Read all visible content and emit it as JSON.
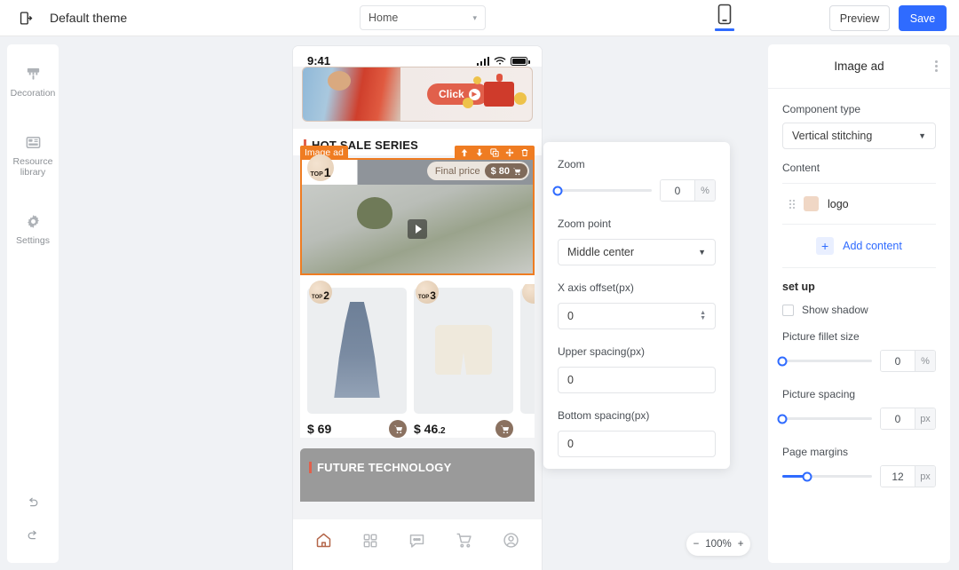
{
  "header": {
    "exit_icon": "exit-icon",
    "theme_title": "Default theme",
    "page_select": {
      "value": "Home",
      "caret": "▾"
    },
    "device_icon": "mobile-device-icon",
    "preview_label": "Preview",
    "save_label": "Save",
    "accent_color": "#2f6bff"
  },
  "sidebar": {
    "items": [
      {
        "icon": "brush-icon",
        "label": "Decoration"
      },
      {
        "icon": "layout-icon",
        "label": "Resource\nlibrary"
      },
      {
        "icon": "gear-icon",
        "label": "Settings"
      }
    ],
    "labels": [
      "Decoration",
      "Resource library",
      "Settings"
    ],
    "resource_line1": "Resource",
    "resource_line2": "library",
    "undo_icon": "undo-icon",
    "redo_icon": "redo-icon"
  },
  "phone": {
    "status": {
      "time": "9:41",
      "signal_icon": "signal-icon",
      "wifi_icon": "wifi-icon",
      "battery_icon": "battery-icon"
    },
    "banner": {
      "click_label": "Click",
      "play_glyph": "▶"
    },
    "section_title": "HOT SALE SERIES",
    "selection": {
      "tag": "Image ad",
      "tools": [
        "move-up-icon",
        "move-down-icon",
        "duplicate-icon",
        "drag-move-icon",
        "delete-icon"
      ]
    },
    "hero": {
      "badge_prefix": "TOP",
      "badge_rank": "1",
      "final_price_label": "Final price",
      "price": "$ 80",
      "cart_icon": "cart-icon",
      "play_icon": "play-icon"
    },
    "products": [
      {
        "badge_prefix": "TOP",
        "rank": "2",
        "price": "$ 69",
        "price_decimal": "",
        "cart_icon": "cart-icon"
      },
      {
        "badge_prefix": "TOP",
        "rank": "3",
        "price": "$ 46",
        "price_decimal": ".2",
        "cart_icon": "cart-icon"
      }
    ],
    "next_section_title": "FUTURE TECHNOLOGY",
    "tabbar": [
      {
        "icon": "home-icon",
        "active": true
      },
      {
        "icon": "category-grid-icon",
        "active": false
      },
      {
        "icon": "chat-icon",
        "active": false
      },
      {
        "icon": "cart-icon",
        "active": false
      },
      {
        "icon": "profile-icon",
        "active": false
      }
    ]
  },
  "mid_panel": {
    "zoom_label": "Zoom",
    "zoom_value": "0",
    "zoom_unit": "%",
    "zoom_point_label": "Zoom point",
    "zoom_point_value": "Middle center",
    "x_offset_label": "X axis offset(px)",
    "x_offset_value": "0",
    "upper_spacing_label": "Upper spacing(px)",
    "upper_spacing_value": "0",
    "bottom_spacing_label": "Bottom spacing(px)",
    "bottom_spacing_value": "0"
  },
  "right_panel": {
    "title": "Image ad",
    "menu_icon": "more-vertical-icon",
    "component_type_label": "Component type",
    "component_type_value": "Vertical stitching",
    "content_label": "Content",
    "content_items": [
      {
        "name": "logo",
        "thumb": "logo-thumb"
      }
    ],
    "add_content_label": "Add content",
    "add_icon": "plus-icon",
    "setup_title": "set up",
    "show_shadow_label": "Show shadow",
    "show_shadow_checked": false,
    "fillet_label": "Picture fillet size",
    "fillet_value": "0",
    "fillet_unit": "%",
    "spacing_label": "Picture spacing",
    "spacing_value": "0",
    "spacing_unit": "px",
    "margins_label": "Page margins",
    "margins_value": "12",
    "margins_unit": "px",
    "margins_percent": 28
  },
  "zoom_control": {
    "minus": "−",
    "value": "100%",
    "plus": "+"
  }
}
